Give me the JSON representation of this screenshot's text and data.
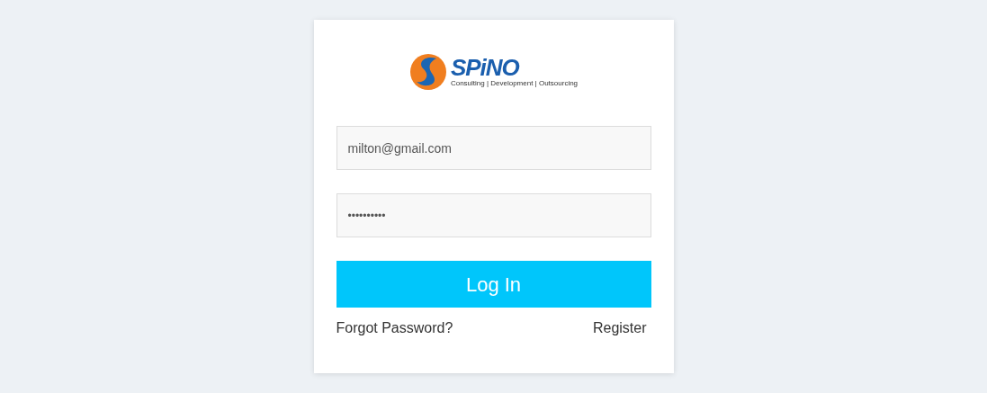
{
  "logo": {
    "name": "SPiNO",
    "tagline": "Consulting | Development | Outsourcing"
  },
  "email_field": {
    "value": "milton@gmail.com"
  },
  "password_field": {
    "value": "••••••••••"
  },
  "login_button": {
    "label": "Log In"
  },
  "links": [
    {
      "label": "Forgot Password?"
    },
    {
      "label": "Register"
    }
  ]
}
